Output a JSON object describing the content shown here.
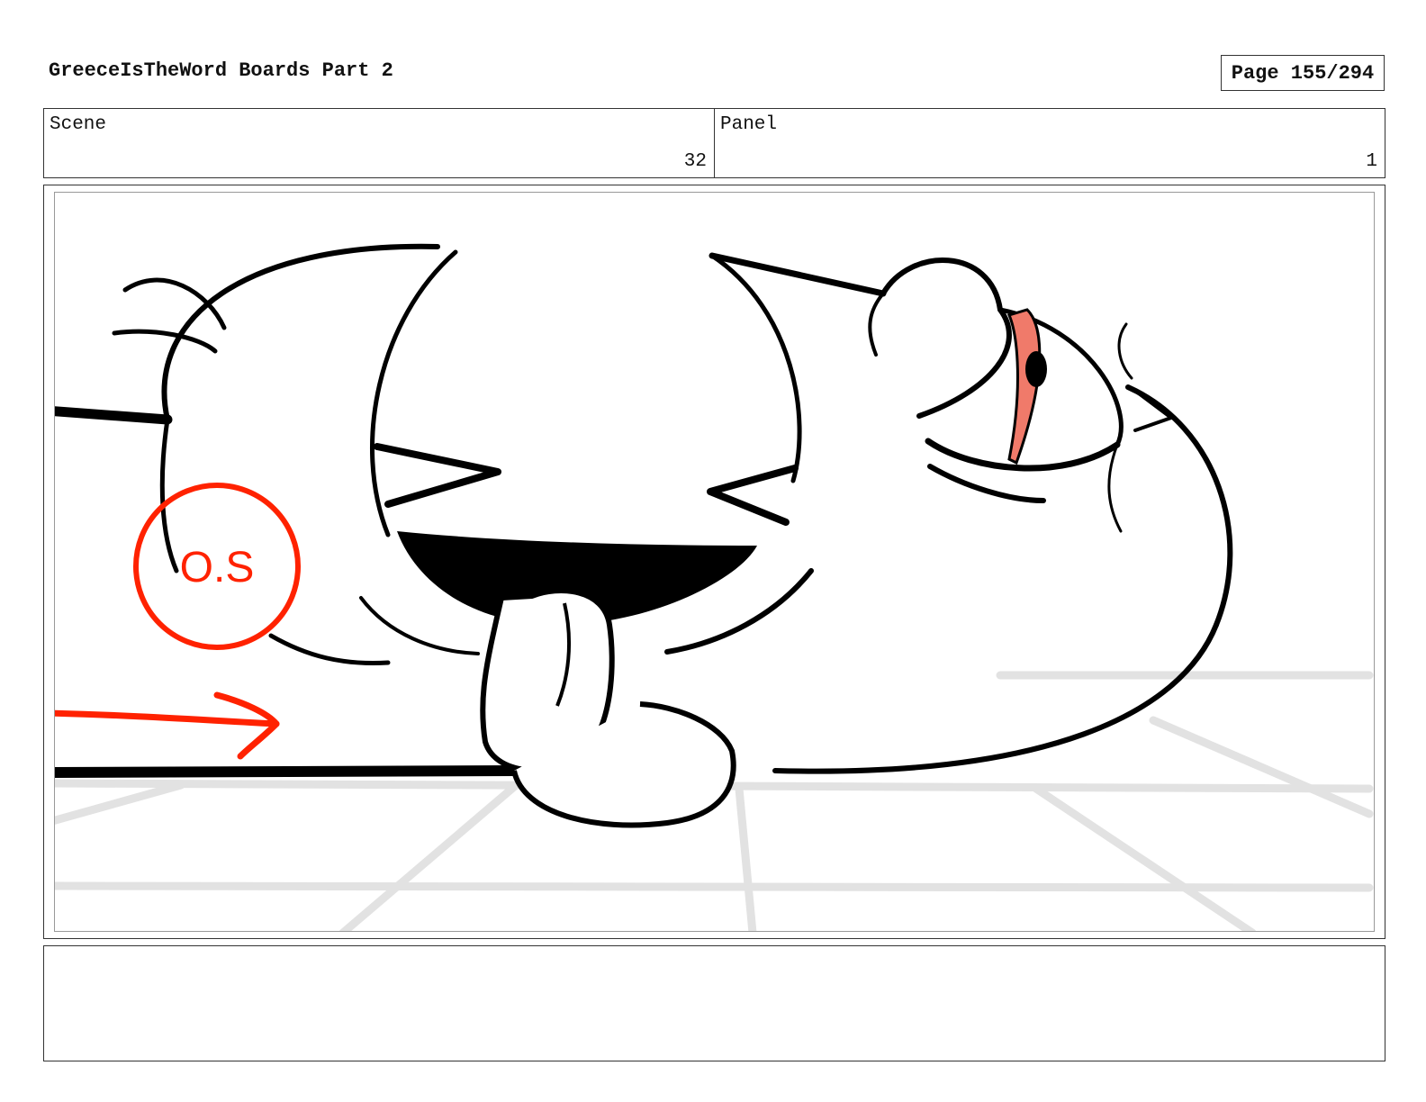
{
  "header": {
    "title": "GreeceIsTheWord Boards Part 2",
    "page": "Page 155/294"
  },
  "info": {
    "scene_label": "Scene",
    "scene_value": "32",
    "panel_label": "Panel",
    "panel_value": "1"
  },
  "drawing": {
    "annotation_text": "O.S",
    "annotation_color": "#ff2200",
    "eye_color": "#f07a6a",
    "line_color": "#000000",
    "floor_color": "#e2e2e2"
  },
  "notes": {
    "text": ""
  }
}
